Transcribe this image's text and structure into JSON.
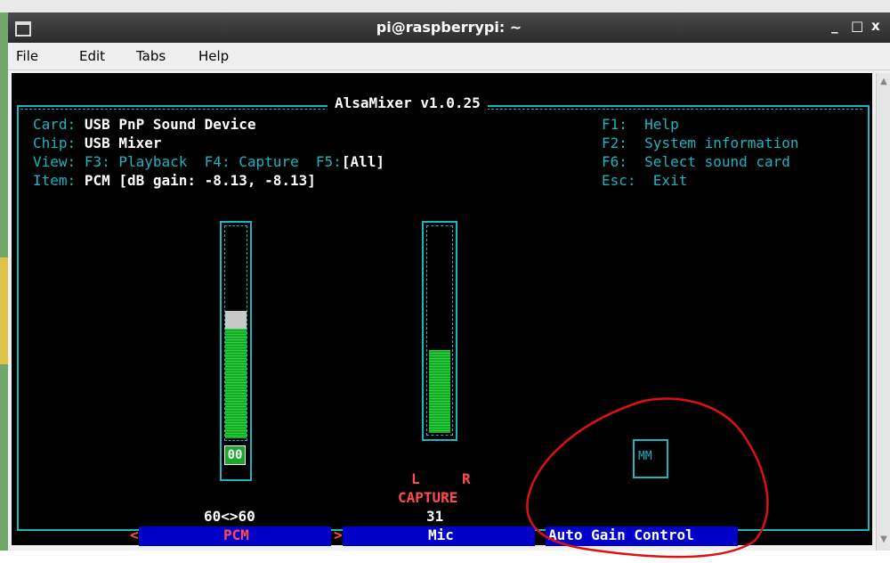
{
  "window": {
    "title": "pi@raspberrypi: ~",
    "controls": [
      "_",
      "□",
      "x"
    ],
    "menu": [
      "File",
      "Edit",
      "Tabs",
      "Help"
    ]
  },
  "header": {
    "title": "AlsaMixer v1.0.25",
    "card_label": "Card:",
    "card_value": "USB PnP Sound Device",
    "chip_label": "Chip:",
    "chip_value": "USB Mixer",
    "view_label": "View:",
    "view_f3": "F3: Playback",
    "view_f4": "F4: Capture",
    "view_f5": "F5:",
    "view_all": "[All]",
    "item_label": "Item:",
    "item_value": "PCM [dB gain: -8.13, -8.13]"
  },
  "shortcuts": [
    {
      "key": "F1:",
      "label": "Help"
    },
    {
      "key": "F2:",
      "label": "System information"
    },
    {
      "key": "F6:",
      "label": "Select sound card"
    },
    {
      "key": "Esc:",
      "label": "Exit"
    }
  ],
  "controls": [
    {
      "name": "PCM",
      "value_text": "60<>60",
      "level": 0.6,
      "mute_text": "00",
      "selected": true,
      "left_marker": "<",
      "right_marker": ">"
    },
    {
      "name": "Mic",
      "value_text": "31",
      "level": 0.4,
      "capture_text": "CAPTURE",
      "lr_left": "L",
      "lr_right": "R"
    },
    {
      "name": "Auto Gain Control",
      "switch_text": "MM"
    }
  ],
  "colors": {
    "terminal_bg": "#000000",
    "frame": "#19b5c0",
    "bar": "#2cd43c",
    "label_bg": "#0000c8",
    "annotation": "#e01010"
  }
}
